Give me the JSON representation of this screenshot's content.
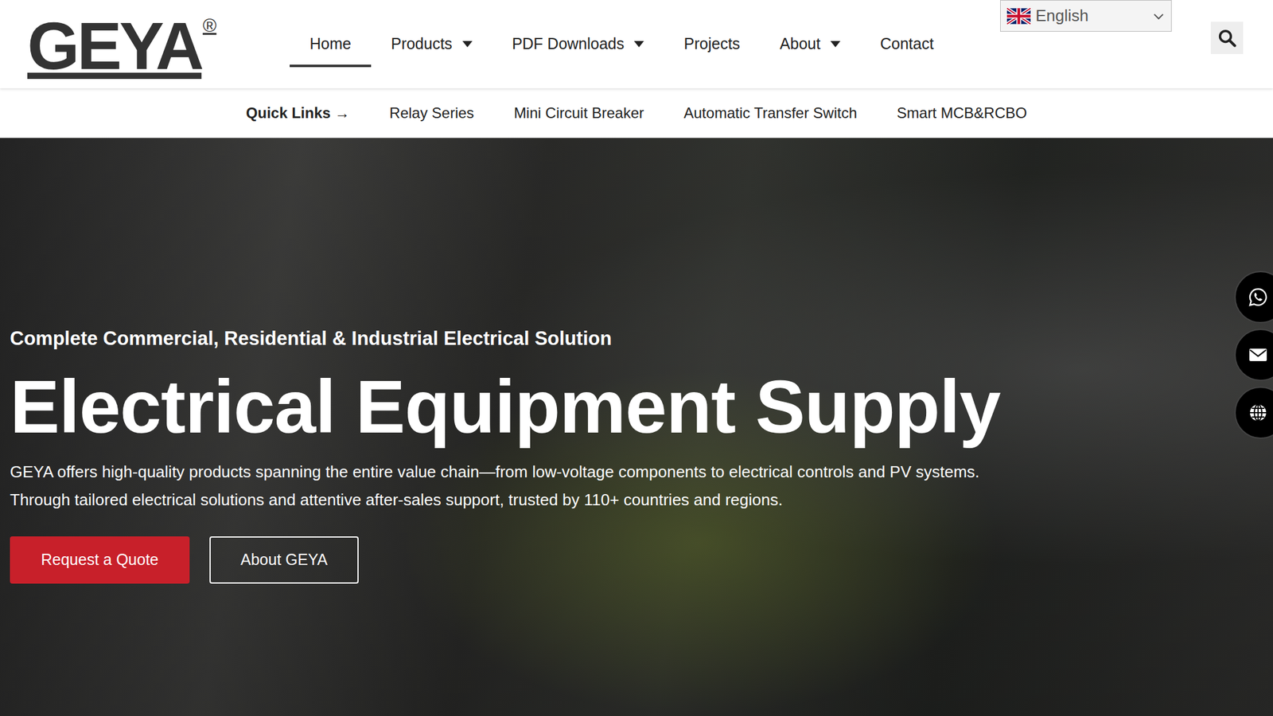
{
  "logo": {
    "text": "GEYA",
    "mark": "®"
  },
  "language": {
    "label": "English"
  },
  "nav": [
    {
      "label": "Home",
      "selected": true,
      "expandable": false
    },
    {
      "label": "Products",
      "selected": false,
      "expandable": true
    },
    {
      "label": "PDF Downloads",
      "selected": false,
      "expandable": true
    },
    {
      "label": "Projects",
      "selected": false,
      "expandable": false
    },
    {
      "label": "About",
      "selected": false,
      "expandable": true
    },
    {
      "label": "Contact",
      "selected": false,
      "expandable": false
    }
  ],
  "quick_links": {
    "label": "Quick Links →",
    "items": [
      "Relay Series",
      "Mini Circuit Breaker",
      "Automatic Transfer Switch",
      "Smart MCB&RCBO"
    ]
  },
  "hero": {
    "eyebrow": "Complete Commercial, Residential & Industrial Electrical Solution",
    "title": "Electrical Equipment Supply",
    "lines": [
      "GEYA offers high-quality products spanning the entire value chain—from low-voltage components to electrical controls and PV systems.",
      "Through tailored electrical solutions and attentive after-sales support, trusted by 110+ countries and regions."
    ],
    "buttons": [
      {
        "label": "Request a Quote",
        "kind": "primary"
      },
      {
        "label": "About GEYA",
        "kind": "outline"
      }
    ]
  },
  "side_contacts": [
    {
      "kind": "whatsapp"
    },
    {
      "kind": "email"
    },
    {
      "kind": "globe"
    }
  ]
}
